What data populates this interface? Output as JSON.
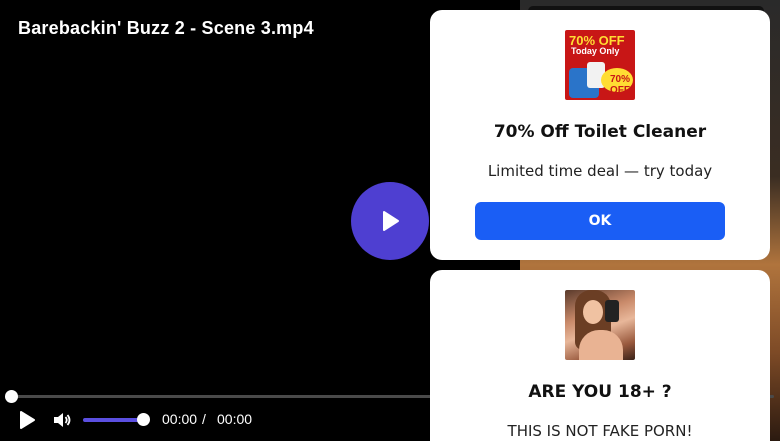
{
  "player": {
    "title": "Barebackin' Buzz 2 - Scene 3.mp4",
    "current_time": "00:00",
    "separator": "/",
    "duration": "00:00",
    "progress": 0.0,
    "volume": 1.0,
    "accent_color": "#4e3fd1"
  },
  "icons": {
    "big_play": "play-icon",
    "play": "play-icon",
    "volume": "volume-icon"
  },
  "popups": [
    {
      "image_text_line1": "70% OFF",
      "image_text_line2": "Today Only",
      "image_badge": "70% OFF",
      "title": "70% Off Toilet Cleaner",
      "subtitle": "Limited time deal — try today",
      "button_label": "OK",
      "button_color": "#1a5ef5"
    },
    {
      "title": "ARE YOU 18+ ?",
      "subtitle": "THIS IS NOT FAKE PORN!"
    }
  ]
}
